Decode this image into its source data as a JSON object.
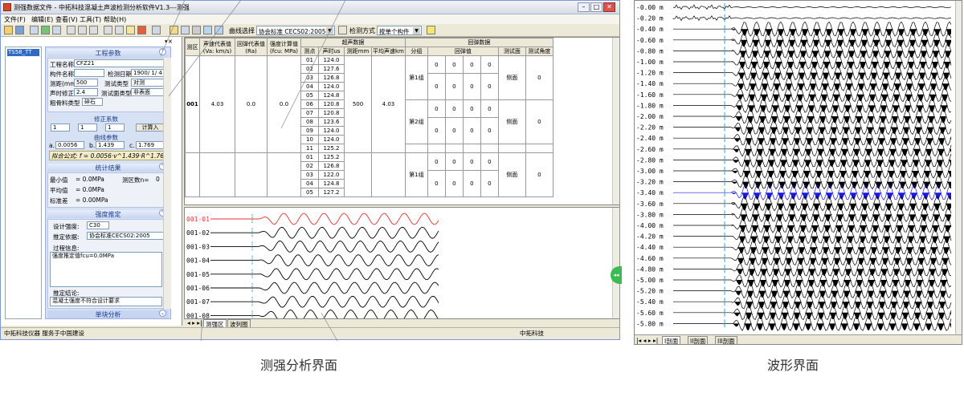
{
  "left_window": {
    "title": "测强数据文件 - 中拓科技混凝土声波检测分析软件V1.3---测强",
    "menu": [
      "文件(F)",
      "编辑(E)",
      "查看(V)",
      "工具(T)",
      "帮助(H)"
    ],
    "toolbar": {
      "curve_label": "曲线选择",
      "curve_value": "协会标准 CECS02:2005",
      "mode_label": "检测方式",
      "mode_value": "按单个构件"
    },
    "tree": {
      "selected": "TS58_TT"
    },
    "project": {
      "title": "工程参数",
      "name_label": "工程名称",
      "name_value": "CFZ21",
      "member_label": "构件名称",
      "date_label": "检测日期",
      "date_value": "1900/ 1/ 4",
      "distance_label": "测距(mm)",
      "distance_value": "500",
      "test_type_label": "测试类型",
      "test_type_value": "对测",
      "coef_label": "声时修正",
      "coef_value": "2.4",
      "surface_label": "测试面类型",
      "surface_value": "非表面",
      "agg_label": "粗骨料类型",
      "agg_value": "碎石"
    },
    "correction": {
      "title": "修正系数",
      "r1": "1",
      "r2": "1",
      "r3": "1",
      "button": "计算入"
    },
    "curve": {
      "title": "曲线参数",
      "a": "0.0056",
      "b": "1.439",
      "c": "1.769",
      "formula": "拟合公式: f = 0.0056·v^1.439·R^1.769"
    },
    "stats": {
      "title": "统计结果",
      "min_label": "最小值",
      "min_value": "= 0.0MPa",
      "count_label": "测区数n=",
      "count_value": "0",
      "avg_label": "平均值",
      "avg_value": "= 0.0MPa",
      "std_label": "标准差",
      "std_value": "= 0.00MPa"
    },
    "estimate": {
      "title": "强度推定",
      "grade_label": "设计强度:",
      "grade_value": "C30",
      "basis_label": "推定依据:",
      "basis_value": "协会标准CECS02:2005",
      "process_label": "过程信息:",
      "process_text": "强度推定值fcu=0.0MPa",
      "conclusion_label": "推定结论:",
      "conclusion_text": "混凝土强度不符合设计要求"
    },
    "bottom_section": "单块分析",
    "table": {
      "headers": [
        "测区",
        "声速代表值 (Va: km/s)",
        "回弹代表值 (Ra)",
        "强度计算值 (fcu: MPa)",
        "测点",
        "声时us",
        "测距mm",
        "平均声速km",
        "分组",
        "回弹值",
        "测试面",
        "测试角度"
      ],
      "group_supersonic": "超声数据",
      "group_rebound": "回弹数据",
      "zone": {
        "id": "001",
        "v": "4.03",
        "r": "0.0",
        "f": "0.0",
        "dist": "500",
        "avg": "4.03"
      },
      "times": [
        "124.0",
        "127.6",
        "126.8",
        "124.0",
        "124.8",
        "120.8",
        "120.8",
        "123.6",
        "124.0",
        "124.0",
        "125.2"
      ],
      "times2": [
        "125.2",
        "126.8",
        "122.0",
        "124.8",
        "127.2"
      ],
      "groups": [
        "第1组",
        "第2组",
        "第1组"
      ],
      "face": "侧面",
      "angle": "0"
    },
    "waves": [
      "001-01",
      "001-02",
      "001-03",
      "001-04",
      "001-05",
      "001-06",
      "001-07",
      "001-08"
    ],
    "tabs": [
      "测强区",
      "波列图"
    ],
    "status_left": "中拓科技仪器 服务于中国建设",
    "status_right": "中拓科技"
  },
  "right_window": {
    "depth_labels": [
      "-0.00 m",
      "-0.20 m",
      "-0.40 m",
      "-0.60 m",
      "-0.80 m",
      "-1.00 m",
      "-1.20 m",
      "-1.40 m",
      "-1.60 m",
      "-1.80 m",
      "-2.00 m",
      "-2.20 m",
      "-2.40 m",
      "-2.60 m",
      "-2.80 m",
      "-3.00 m",
      "-3.20 m",
      "-3.40 m",
      "-3.60 m",
      "-3.80 m",
      "-4.00 m",
      "-4.20 m",
      "-4.40 m",
      "-4.60 m",
      "-4.80 m",
      "-5.00 m",
      "-5.20 m",
      "-5.40 m",
      "-5.60 m",
      "-5.80 m"
    ],
    "tabs": [
      "I剖面",
      "II剖面",
      "III剖面"
    ]
  },
  "captions": {
    "left": "测强分析界面",
    "right": "波形界面"
  },
  "colors": {
    "highlight_wave": "#e83030",
    "highlight_trace": "#1a1adc",
    "selection": "#316ac5"
  }
}
